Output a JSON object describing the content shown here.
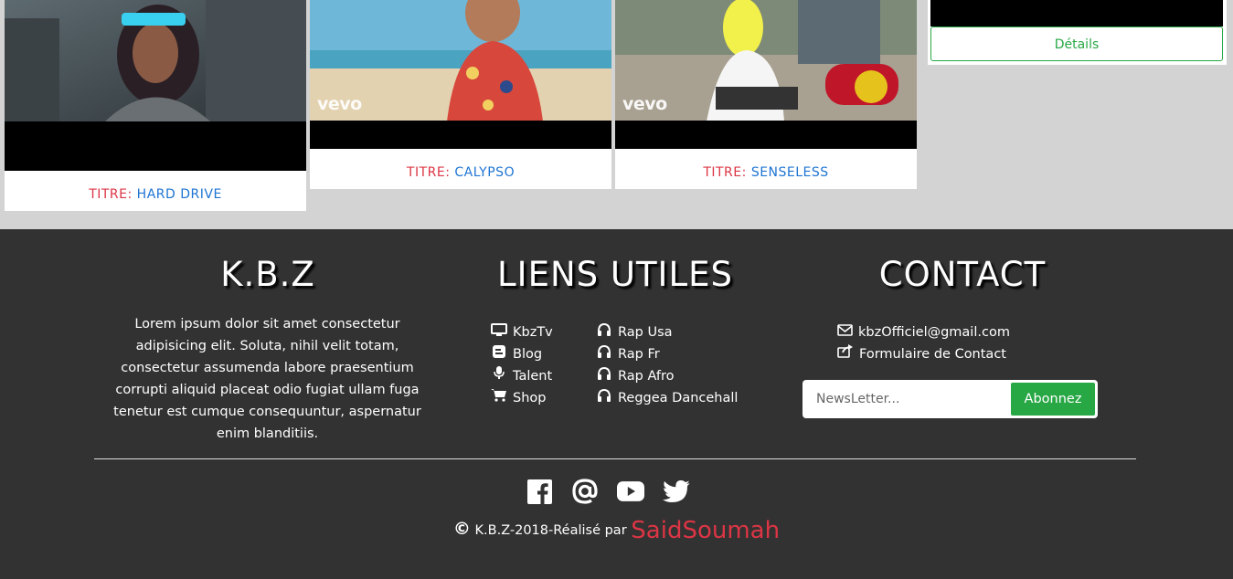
{
  "videos": [
    {
      "title_label": "TITRE:",
      "title_value": "HARD DRIVE",
      "watermark": ""
    },
    {
      "title_label": "TITRE:",
      "title_value": "CALYPSO",
      "watermark": "vevo"
    },
    {
      "title_label": "TITRE:",
      "title_value": "SENSELESS",
      "watermark": "vevo"
    }
  ],
  "details_label": "Détails",
  "footer": {
    "brand": {
      "title": "K.B.Z",
      "text": "Lorem ipsum dolor sit amet consectetur adipisicing elit. Soluta, nihil velit totam, consectetur assumenda labore praesentium corrupti aliquid placeat odio fugiat ullam fuga tenetur est cumque consequuntur, aspernatur enim blanditiis."
    },
    "links": {
      "title": "LIENS UTILES",
      "left": [
        {
          "label": "KbzTv",
          "icon": "tv-icon"
        },
        {
          "label": "Blog",
          "icon": "blog-icon"
        },
        {
          "label": "Talent",
          "icon": "microphone-icon"
        },
        {
          "label": "Shop",
          "icon": "cart-icon"
        }
      ],
      "right": [
        {
          "label": "Rap Usa",
          "icon": "headphones-icon"
        },
        {
          "label": "Rap Fr",
          "icon": "headphones-icon"
        },
        {
          "label": "Rap Afro",
          "icon": "headphones-icon"
        },
        {
          "label": "Reggea Dancehall",
          "icon": "headphones-icon"
        }
      ]
    },
    "contact": {
      "title": "CONTACT",
      "email": "kbzOfficiel@gmail.com",
      "form_link": "Formulaire de Contact",
      "newsletter_placeholder": "NewsLetter...",
      "subscribe_label": "Abonnez"
    },
    "socials": [
      "facebook-icon",
      "at-icon",
      "youtube-icon",
      "twitter-icon"
    ],
    "copyright": {
      "symbol": "©",
      "text": "K.B.Z-2018-Réalisé par",
      "author": "SaidSoumah"
    }
  },
  "colors": {
    "accent_red": "#dc3545",
    "accent_blue": "#1e74d3",
    "accent_green": "#28a745",
    "footer_bg": "#333232",
    "page_bg": "#d3d3d3"
  }
}
